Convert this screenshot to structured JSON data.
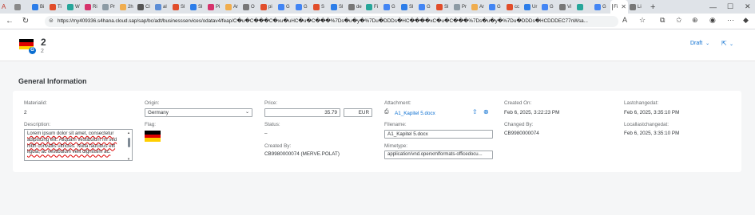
{
  "browser": {
    "tabs": [
      {
        "label": "",
        "color": "#8a8a8a"
      },
      {
        "label": "Bi",
        "color": "#2b7de9"
      },
      {
        "label": "Ti",
        "color": "#e14d2a"
      },
      {
        "label": "W",
        "color": "#26a69a"
      },
      {
        "label": "Ri",
        "color": "#d6336c"
      },
      {
        "label": "Pr",
        "color": "#8c9ba5"
      },
      {
        "label": "2h",
        "color": "#f0ad4e"
      },
      {
        "label": "Cl",
        "color": "#555"
      },
      {
        "label": "al",
        "color": "#5b8dd6"
      },
      {
        "label": "Sl",
        "color": "#e14d2a"
      },
      {
        "label": "Sl",
        "color": "#2b7de9"
      },
      {
        "label": "Pi",
        "color": "#d6336c"
      },
      {
        "label": "Ar",
        "color": "#f0ad4e"
      },
      {
        "label": "O",
        "color": "#777"
      },
      {
        "label": "pi",
        "color": "#e14d2a"
      },
      {
        "label": "G",
        "color": "#4285f4"
      },
      {
        "label": "G",
        "color": "#4285f4"
      },
      {
        "label": "S",
        "color": "#e14d2a"
      },
      {
        "label": "Sl",
        "color": "#2b7de9"
      },
      {
        "label": "de",
        "color": "#777"
      },
      {
        "label": "Fi",
        "color": "#26a69a"
      },
      {
        "label": "G",
        "color": "#4285f4"
      },
      {
        "label": "Sl",
        "color": "#2b7de9"
      },
      {
        "label": "G",
        "color": "#4285f4"
      },
      {
        "label": "Sl",
        "color": "#e14d2a"
      },
      {
        "label": "Pr",
        "color": "#8c9ba5"
      },
      {
        "label": "Ar",
        "color": "#f0ad4e"
      },
      {
        "label": "G",
        "color": "#4285f4"
      },
      {
        "label": "cc",
        "color": "#e14d2a"
      },
      {
        "label": "Ur",
        "color": "#2b7de9"
      },
      {
        "label": "G",
        "color": "#4285f4"
      },
      {
        "label": "Vi",
        "color": "#777"
      },
      {
        "label": "",
        "color": "#26a69a"
      },
      {
        "label": "G",
        "color": "#4285f4"
      },
      {
        "label": "Fi",
        "color": "#777"
      },
      {
        "label": "Li",
        "color": "#777"
      }
    ],
    "active_tab_index": 34,
    "tab_close": "✕",
    "new_tab": "+",
    "minimize": "—",
    "maximize": "☐",
    "close": "✕",
    "back": "←",
    "reload": "↻",
    "url": "https://my409336.s4hana.cloud.sap/sap/bc/adt/businessservices/odatav4/feap/C�u�C���C�xu�uHC�u�C���%7Ds�u�y�%7Du�DDDs�HC����xC�u�C���%7Ds�u�y�%7Du�DDDs�HCDDDEC77nWsa..."
  },
  "header": {
    "title": "2",
    "subtitle": "2",
    "badge": "G",
    "draft_label": "Draft",
    "draft_icon": "chevron-down-icon",
    "share_icon": "share-icon",
    "flag_colors": [
      "#000000",
      "#dd0000",
      "#ffce00"
    ]
  },
  "section": {
    "title": "General Information"
  },
  "fields": {
    "materialid_label": "Materialid:",
    "materialid_value": "2",
    "description_label": "Description:",
    "description_lines": [
      "Lorem ipsum dolor sit amet, consectetur",
      "adipiscing elit. Aliquam vestibulum mi sed",
      "nibh convallis ultricies. Nulla faucibus elit",
      "ligula, ac vestibulum velit dignissim ac."
    ],
    "origin_label": "Origin:",
    "origin_value": "Germany",
    "flag_label": "Flag:",
    "price_label": "Price:",
    "price_value": "35.79",
    "currency_value": "EUR",
    "status_label": "Status:",
    "status_value": "–",
    "created_by_label": "Created By:",
    "created_by_value": "CB9980000074 (MERVE.POLAT)",
    "attachment_label": "Attachment:",
    "attachment_value": "A1_Kapitel 5.docx",
    "filename_label": "Filename:",
    "filename_value": "A1_Kapitel 5.docx",
    "mimetype_label": "Mimetype:",
    "mimetype_value": "application/vnd.openxmlformats-officedocu...",
    "created_on_label": "Created On:",
    "created_on_value": "Feb 6, 2025, 3:22:23 PM",
    "changed_by_label": "Changed By:",
    "changed_by_value": "CB9980000074",
    "lastchangedat_label": "Lastchangedat:",
    "lastchangedat_value": "Feb 6, 2025, 3:35:10 PM",
    "locallastchangedat_label": "Locallastchangedat:",
    "locallastchangedat_value": "Feb 6, 2025, 3:35:10 PM"
  }
}
